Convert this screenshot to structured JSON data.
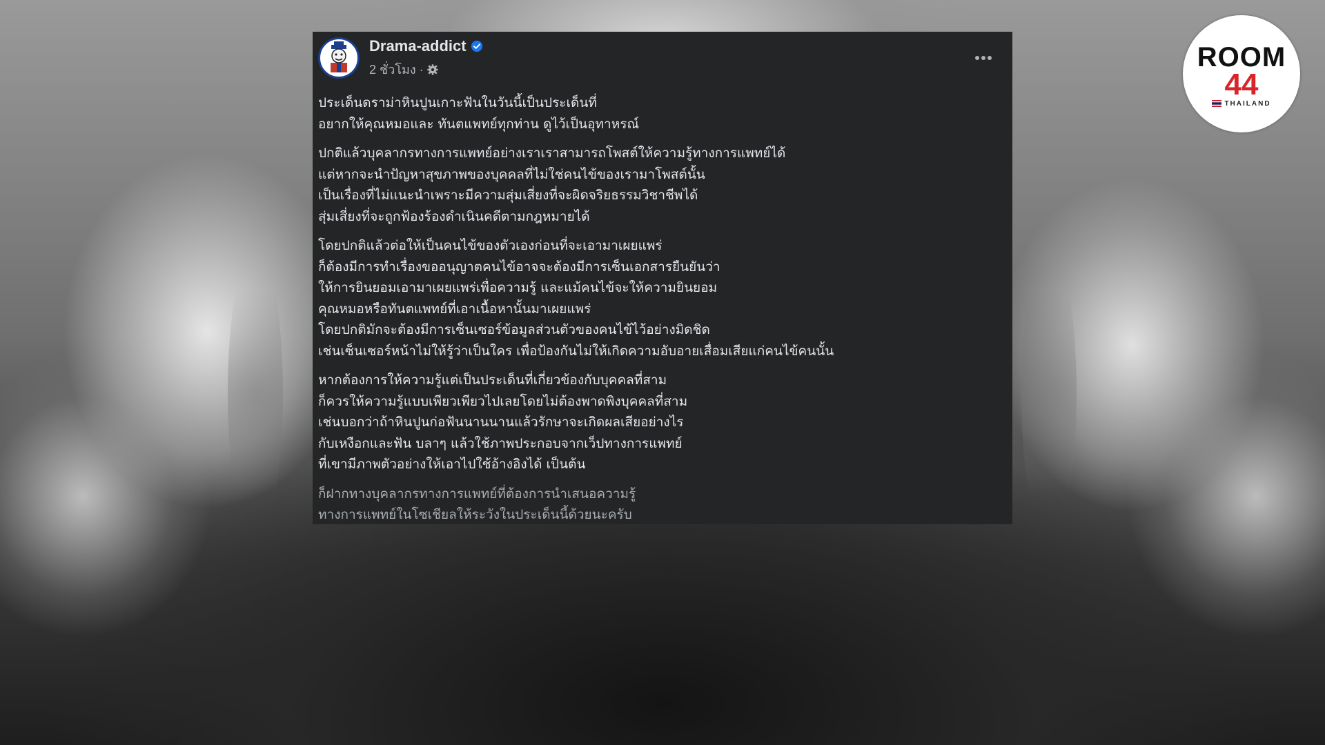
{
  "post": {
    "author": "Drama-addict",
    "time": "2 ชั่วโมง ·",
    "paragraphs": [
      {
        "lines": [
          "ประเด็นดราม่าหินปูนเกาะฟันในวันนี้เป็นประเด็นที่",
          "อยากให้คุณหมอและ ทันตแพทย์ทุกท่าน ดูไว้เป็นอุทาหรณ์"
        ]
      },
      {
        "lines": [
          "ปกติแล้วบุคลากรทางการแพทย์อย่างเราเราสามารถโพสต์ให้ความรู้ทางการแพทย์ได้",
          " แต่หากจะนำปัญหาสุขภาพของบุคคลที่ไม่ใช่คนไข้ของเรามาโพสต์นั้น",
          "เป็นเรื่องที่ไม่แนะนำเพราะมีความสุ่มเสี่ยงที่จะผิดจริยธรรมวิชาชีพได้",
          "สุ่มเสี่ยงที่จะถูกฟ้องร้องดำเนินคดีตามกฎหมายได้"
        ]
      },
      {
        "lines": [
          "โดยปกติแล้วต่อให้เป็นคนไข้ของตัวเองก่อนที่จะเอามาเผยแพร่",
          "ก็ต้องมีการทำเรื่องขออนุญาตคนไข้อาจจะต้องมีการเซ็นเอกสารยืนยันว่า",
          "ให้การยินยอมเอามาเผยแพร่เพื่อความรู้ และแม้คนไข้จะให้ความยินยอม",
          "คุณหมอหรือทันตแพทย์ที่เอาเนื้อหานั้นมาเผยแพร่",
          "โดยปกติมักจะต้องมีการเซ็นเซอร์ข้อมูลส่วนตัวของคนไข้ไว้อย่างมิดชิด",
          " เช่นเซ็นเซอร์หน้าไม่ให้รู้ว่าเป็นใคร เพื่อป้องกันไม่ให้เกิดความอับอายเสื่อมเสียแก่คนไข้คนนั้น"
        ]
      },
      {
        "lines": [
          "หากต้องการให้ความรู้แต่เป็นประเด็นที่เกี่ยวข้องกับบุคคลที่สาม",
          "ก็ควรให้ความรู้แบบเพียวเพียวไปเลยโดยไม่ต้องพาดพิงบุคคลที่สาม",
          "เช่นบอกว่าถ้าหินปูนก่อฟันนานนานแล้วรักษาจะเกิดผลเสียอย่างไร",
          "กับเหงือกและฟัน บลาๆ แล้วใช้ภาพประกอบจากเว็ปทางการแพทย์",
          "ที่เขามีภาพตัวอย่างให้เอาไปใช้อ้างอิงได้ เป็นต้น"
        ]
      },
      {
        "lines": [
          "ก็ฝากทางบุคลากรทางการแพทย์ที่ต้องการนำเสนอความรู้",
          "ทางการแพทย์ในโซเชียลให้ระวังในประเด็นนี้ด้วยนะครับ"
        ]
      }
    ]
  },
  "logo": {
    "line1": "ROOM",
    "line2": "44",
    "country": "THAILAND"
  },
  "icons": {
    "verified": "verified-badge-icon",
    "privacy": "gear-icon",
    "more": "more-options-icon"
  },
  "colors": {
    "card_bg": "#242526",
    "text": "#e4e6eb",
    "muted": "#b0b3b8",
    "verified": "#1877f2",
    "brand_red": "#d9252a"
  }
}
